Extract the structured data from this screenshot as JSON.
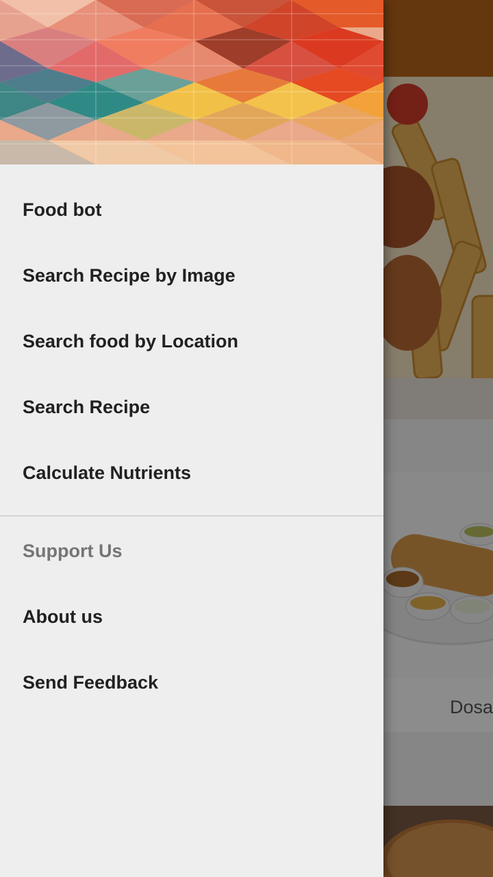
{
  "drawer": {
    "primary_items": [
      {
        "label": "Food bot"
      },
      {
        "label": "Search Recipe by Image"
      },
      {
        "label": "Search food by Location"
      },
      {
        "label": "Search Recipe"
      },
      {
        "label": "Calculate Nutrients"
      }
    ],
    "section_header": "Support Us",
    "secondary_items": [
      {
        "label": "About us"
      },
      {
        "label": "Send Feedback"
      }
    ]
  },
  "background": {
    "card_2_title": "Dosa"
  },
  "colors": {
    "app_bar": "#b8651b",
    "drawer_bg": "#eeeeee",
    "menu_text": "#212121",
    "subheader_text": "#757575",
    "scrim": "rgba(0,0,0,0.45)"
  }
}
